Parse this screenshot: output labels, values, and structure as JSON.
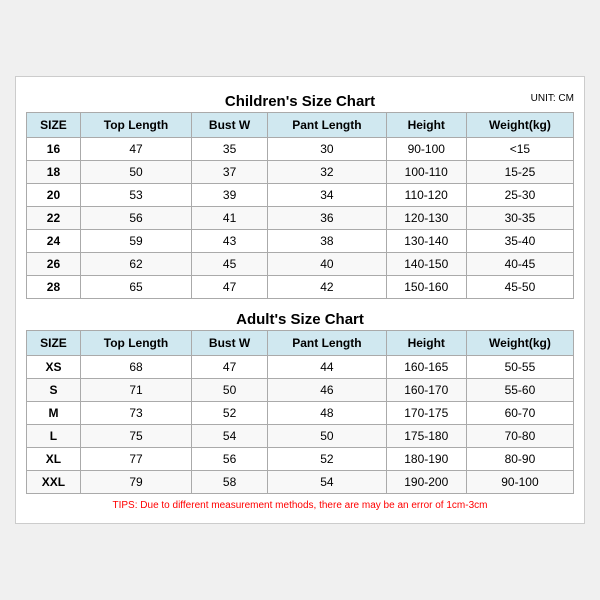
{
  "children_title": "Children's Size Chart",
  "adult_title": "Adult's Size Chart",
  "unit": "UNIT: CM",
  "tips": "TIPS: Due to different measurement methods, there are may be an error of 1cm-3cm",
  "headers": [
    "SIZE",
    "Top Length",
    "Bust W",
    "Pant Length",
    "Height",
    "Weight(kg)"
  ],
  "children_rows": [
    [
      "16",
      "47",
      "35",
      "30",
      "90-100",
      "<15"
    ],
    [
      "18",
      "50",
      "37",
      "32",
      "100-110",
      "15-25"
    ],
    [
      "20",
      "53",
      "39",
      "34",
      "110-120",
      "25-30"
    ],
    [
      "22",
      "56",
      "41",
      "36",
      "120-130",
      "30-35"
    ],
    [
      "24",
      "59",
      "43",
      "38",
      "130-140",
      "35-40"
    ],
    [
      "26",
      "62",
      "45",
      "40",
      "140-150",
      "40-45"
    ],
    [
      "28",
      "65",
      "47",
      "42",
      "150-160",
      "45-50"
    ]
  ],
  "adult_rows": [
    [
      "XS",
      "68",
      "47",
      "44",
      "160-165",
      "50-55"
    ],
    [
      "S",
      "71",
      "50",
      "46",
      "160-170",
      "55-60"
    ],
    [
      "M",
      "73",
      "52",
      "48",
      "170-175",
      "60-70"
    ],
    [
      "L",
      "75",
      "54",
      "50",
      "175-180",
      "70-80"
    ],
    [
      "XL",
      "77",
      "56",
      "52",
      "180-190",
      "80-90"
    ],
    [
      "XXL",
      "79",
      "58",
      "54",
      "190-200",
      "90-100"
    ]
  ]
}
